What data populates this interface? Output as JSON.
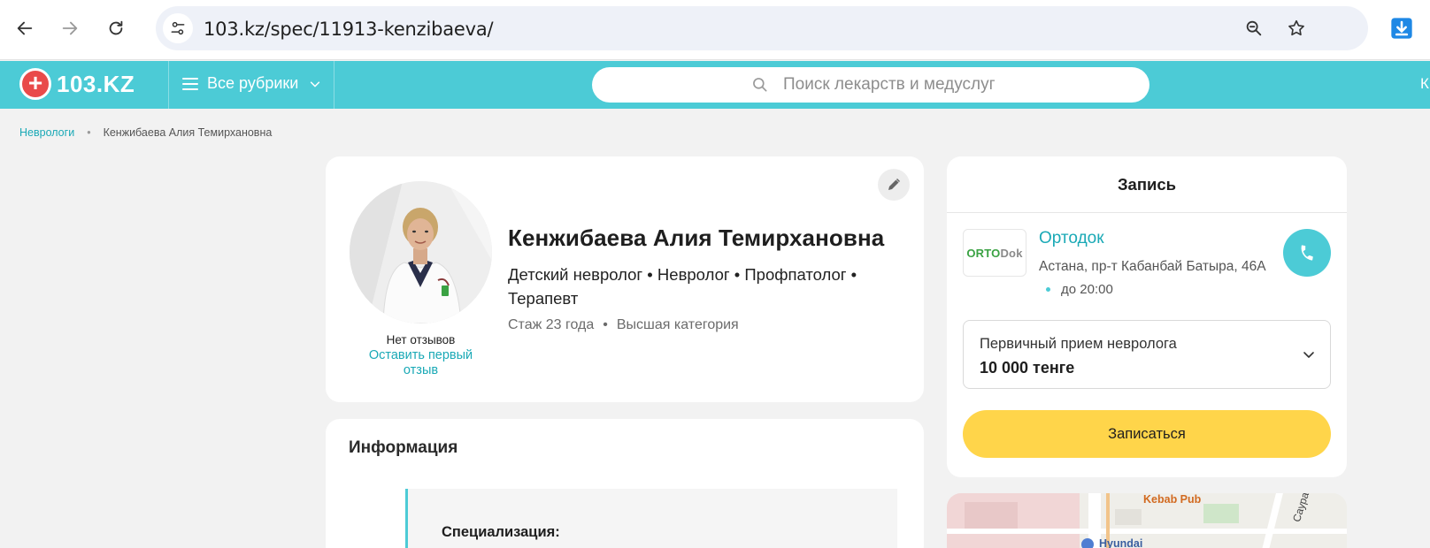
{
  "browser": {
    "url": "103.kz/spec/11913-kenzibaeva/"
  },
  "header": {
    "logo_text": "103.KZ",
    "logo_symbol": "+",
    "rubrics_label": "Все рубрики",
    "search_placeholder": "Поиск лекарств и медуслуг",
    "right_cut_text": "К"
  },
  "breadcrumb": {
    "parent": "Неврологи",
    "separator": "•",
    "current": "Кенжибаева Алия Темирхановна"
  },
  "profile": {
    "name": "Кенжибаева Алия Темирхановна",
    "specialties": "Детский невролог • Невролог • Профпатолог • Терапевт",
    "experience": "Стаж 23 года",
    "meta_separator": "•",
    "category": "Высшая категория",
    "no_reviews": "Нет отзывов",
    "leave_review": "Оставить первый отзыв"
  },
  "info": {
    "title": "Информация",
    "specialization_label": "Специализация:"
  },
  "booking": {
    "title": "Запись",
    "clinic_logo_part1": "ORTO",
    "clinic_logo_part2": "Dok",
    "clinic_name": "Ортодок",
    "clinic_address": "Астана, пр-т Кабанбай Батыра, 46А",
    "clinic_hours": "до 20:00",
    "service_name": "Первичный прием невролога",
    "service_price": "10 000 тенге",
    "book_label": "Записаться"
  },
  "map": {
    "label_kebab": "Kebab Pub",
    "label_hyundai": "Hyundai",
    "label_street": "Сауран"
  },
  "colors": {
    "accent": "#4ccbd6",
    "link": "#1aa9b6",
    "book_button": "#ffd54a",
    "logo_red": "#e94a4a"
  }
}
